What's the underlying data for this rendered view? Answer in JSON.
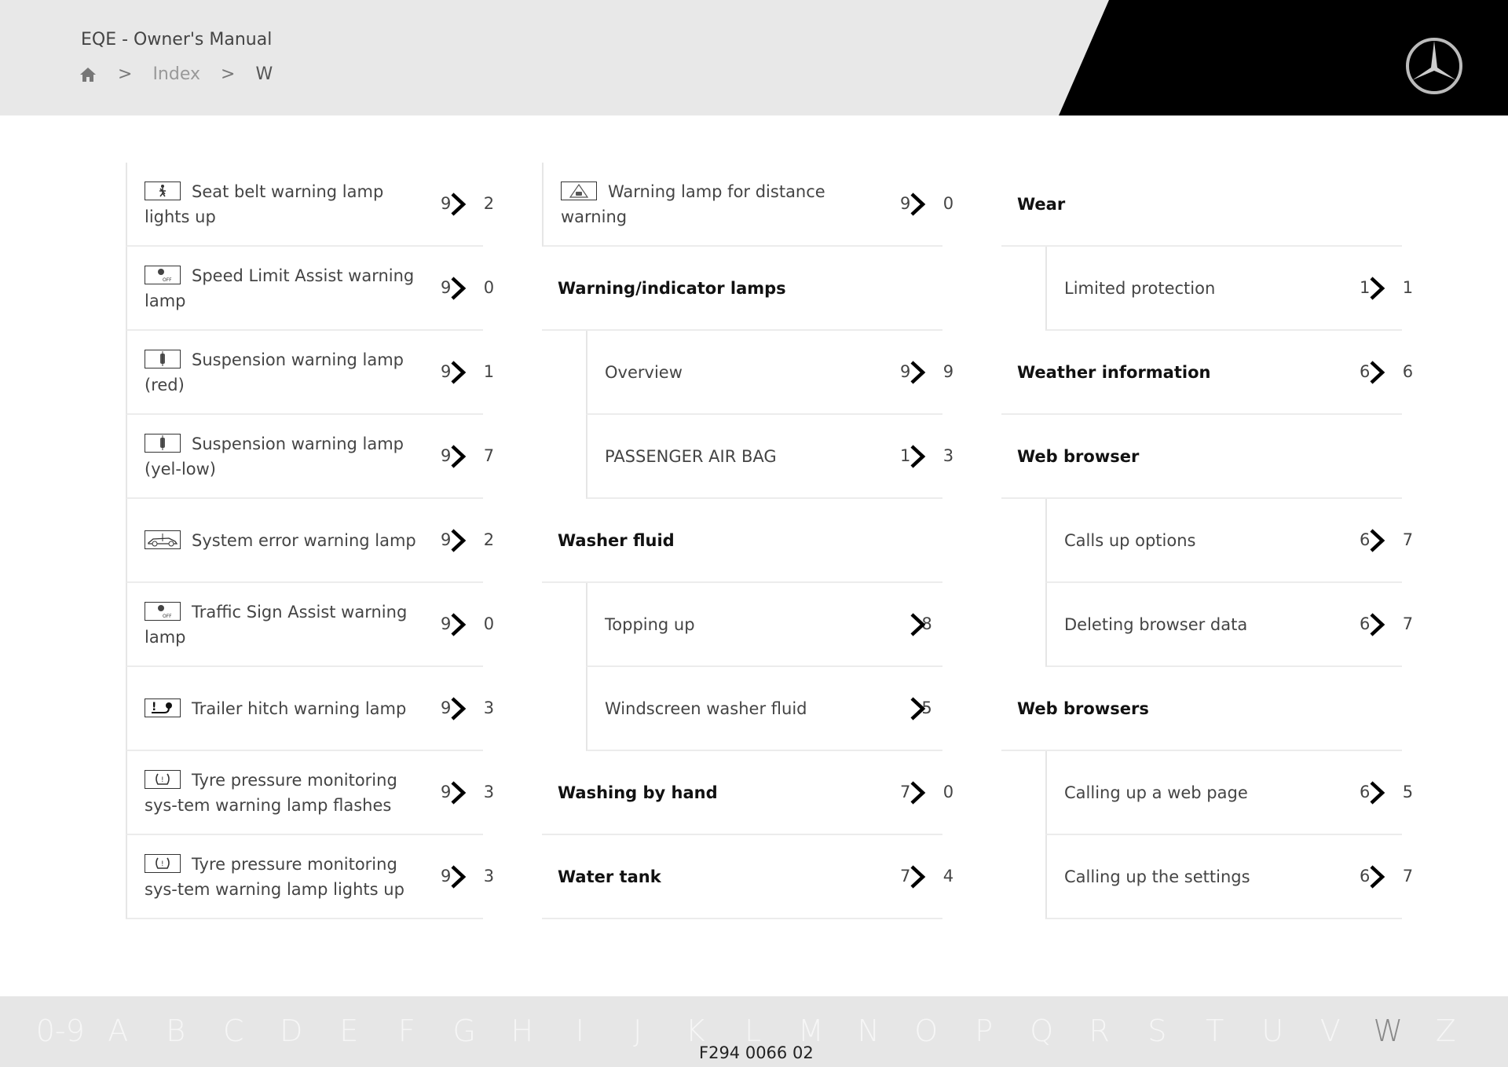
{
  "header": {
    "title": "EQE - Owner's Manual",
    "breadcrumb": {
      "home_icon": "home-icon",
      "items": [
        "Index",
        "W"
      ]
    },
    "logo": "mercedes-star-logo"
  },
  "columns": [
    {
      "rows": [
        {
          "type": "icon",
          "icon": "seat-belt-lamp-icon",
          "label": "Seat belt warning lamp lights up",
          "page_visible": [
            "9",
            "2"
          ]
        },
        {
          "type": "icon",
          "icon": "speed-limit-lamp-icon",
          "label": "Speed Limit Assist warning lamp",
          "page_visible": [
            "9",
            "0"
          ]
        },
        {
          "type": "icon",
          "icon": "suspension-lamp-icon",
          "label": "Suspension warning lamp (red)",
          "page_visible": [
            "9",
            "1"
          ]
        },
        {
          "type": "icon",
          "icon": "suspension-lamp-icon",
          "label": "Suspension warning lamp (yel-low)",
          "page_visible": [
            "9",
            "7"
          ]
        },
        {
          "type": "icon",
          "icon": "system-error-lamp-icon",
          "label": "System error warning lamp",
          "page_visible": [
            "9",
            "2"
          ]
        },
        {
          "type": "icon",
          "icon": "traffic-sign-lamp-icon",
          "label": "Traffic Sign Assist warning lamp",
          "page_visible": [
            "9",
            "0"
          ]
        },
        {
          "type": "icon",
          "icon": "trailer-hitch-lamp-icon",
          "label": "Trailer hitch warning lamp",
          "page_visible": [
            "9",
            "3"
          ]
        },
        {
          "type": "icon",
          "icon": "tyre-pressure-lamp-icon",
          "label": "Tyre pressure monitoring sys-tem warning lamp flashes",
          "page_visible": [
            "9",
            "3"
          ]
        },
        {
          "type": "icon",
          "icon": "tyre-pressure-lamp-icon",
          "label": "Tyre pressure monitoring sys-tem warning lamp lights up",
          "page_visible": [
            "9",
            "3"
          ]
        }
      ]
    },
    {
      "rows": [
        {
          "type": "icon",
          "icon": "distance-warning-lamp-icon",
          "label": "Warning lamp for distance warning",
          "page_visible": [
            "9",
            "0"
          ]
        },
        {
          "type": "heading",
          "label": "Warning/indicator lamps"
        },
        {
          "type": "sub",
          "label": "Overview",
          "page_visible": [
            "9",
            "9"
          ]
        },
        {
          "type": "sub",
          "label": "PASSENGER AIR BAG",
          "page_visible": [
            "1",
            "3"
          ]
        },
        {
          "type": "heading",
          "label": "Washer fluid"
        },
        {
          "type": "sub",
          "label": "Topping up",
          "page_visible": [
            "",
            "8"
          ]
        },
        {
          "type": "sub",
          "label": "Windscreen washer fluid",
          "page_visible": [
            "",
            "5"
          ]
        },
        {
          "type": "heading",
          "label": "Washing by hand",
          "page_visible": [
            "7",
            "0"
          ]
        },
        {
          "type": "heading",
          "label": "Water tank",
          "page_visible": [
            "7",
            "4"
          ]
        }
      ]
    },
    {
      "rows": [
        {
          "type": "heading",
          "label": "Wear"
        },
        {
          "type": "sub",
          "label": "Limited protection",
          "page_visible": [
            "1",
            "1"
          ]
        },
        {
          "type": "heading",
          "label": "Weather information",
          "page_visible": [
            "6",
            "6"
          ]
        },
        {
          "type": "heading",
          "label": "Web browser"
        },
        {
          "type": "sub",
          "label": "Calls up options",
          "page_visible": [
            "6",
            "7"
          ]
        },
        {
          "type": "sub",
          "label": "Deleting browser data",
          "page_visible": [
            "6",
            "7"
          ]
        },
        {
          "type": "heading",
          "label": "Web browsers"
        },
        {
          "type": "sub",
          "label": "Calling up a web page",
          "page_visible": [
            "6",
            "5"
          ]
        },
        {
          "type": "sub",
          "label": "Calling up the settings",
          "page_visible": [
            "6",
            "7"
          ]
        }
      ]
    }
  ],
  "footer": {
    "alphabet": [
      "0-9",
      "A",
      "B",
      "C",
      "D",
      "E",
      "F",
      "G",
      "H",
      "I",
      "J",
      "K",
      "L",
      "M",
      "N",
      "O",
      "P",
      "Q",
      "R",
      "S",
      "T",
      "U",
      "V",
      "W",
      "Z"
    ],
    "active_letter": "W",
    "image_code": "F294 0066 02"
  }
}
